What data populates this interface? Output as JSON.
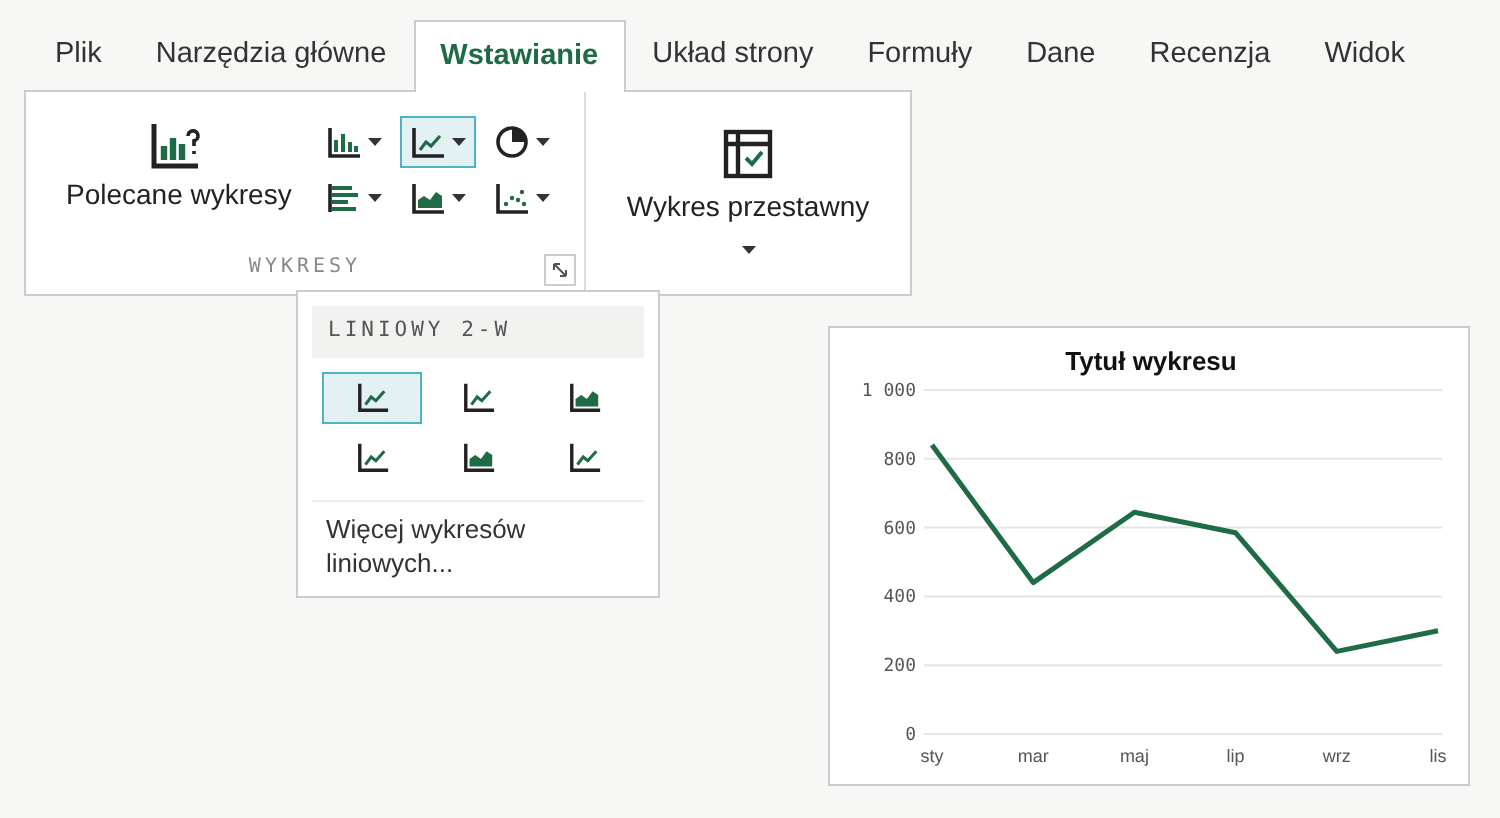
{
  "tabs": [
    {
      "label": "Plik",
      "selected": false
    },
    {
      "label": "Narzędzia główne",
      "selected": false
    },
    {
      "label": "Wstawianie",
      "selected": true
    },
    {
      "label": "Układ strony",
      "selected": false
    },
    {
      "label": "Formuły",
      "selected": false
    },
    {
      "label": "Dane",
      "selected": false
    },
    {
      "label": "Recenzja",
      "selected": false
    },
    {
      "label": "Widok",
      "selected": false
    }
  ],
  "ribbon": {
    "charts_group": {
      "label": "WYKRESY",
      "recommended": {
        "label": "Polecane wykresy"
      },
      "gallery": [
        {
          "kind": "column",
          "selected": false
        },
        {
          "kind": "line",
          "selected": true
        },
        {
          "kind": "pie",
          "selected": false
        },
        {
          "kind": "bar",
          "selected": false
        },
        {
          "kind": "area",
          "selected": false
        },
        {
          "kind": "scatter",
          "selected": false
        }
      ]
    },
    "pivot": {
      "label": "Wykres przestawny"
    }
  },
  "dropdown": {
    "header": "LINIOWY 2-W",
    "items": [
      {
        "kind": "line",
        "selected": true
      },
      {
        "kind": "line",
        "selected": false
      },
      {
        "kind": "area",
        "selected": false
      },
      {
        "kind": "line",
        "selected": false
      },
      {
        "kind": "area",
        "selected": false
      },
      {
        "kind": "line",
        "selected": false
      }
    ],
    "more": "Więcej wykresów liniowych..."
  },
  "chart": {
    "chart_data": {
      "type": "line",
      "title": "Tytuł wykresu",
      "categories": [
        "sty",
        "mar",
        "maj",
        "lip",
        "wrz",
        "lis"
      ],
      "series": [
        {
          "color": "#1e6b45",
          "values": [
            840,
            440,
            645,
            585,
            240,
            300
          ]
        }
      ],
      "ylim": [
        0,
        1000
      ],
      "grid": true,
      "yticks": [
        0,
        200,
        400,
        600,
        800,
        {
          "value": 1000,
          "label": "1 000"
        }
      ]
    }
  }
}
